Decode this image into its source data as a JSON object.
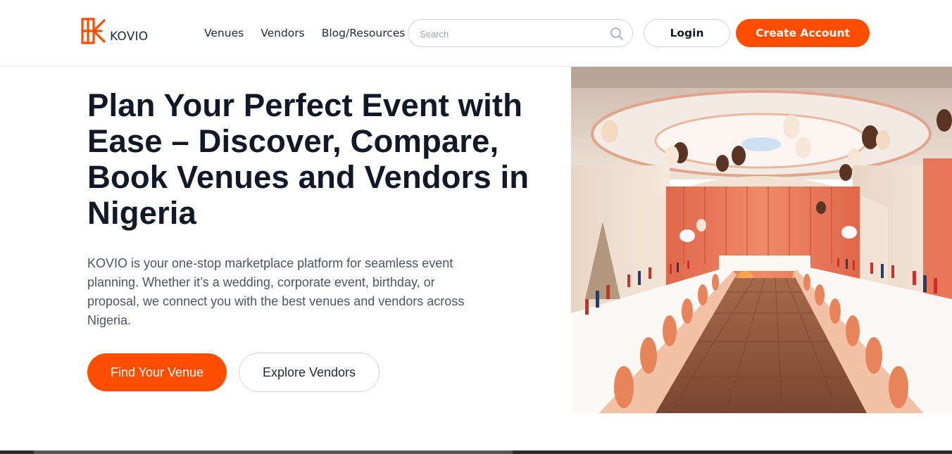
{
  "brand": {
    "name": "KOVIO",
    "accent_color": "#ff4d00"
  },
  "nav": {
    "items": [
      {
        "label": "Venues"
      },
      {
        "label": "Vendors"
      },
      {
        "label": "Blog/Resources"
      }
    ]
  },
  "search": {
    "placeholder": "Search",
    "icon": "search-icon"
  },
  "auth": {
    "login_label": "Login",
    "create_account_label": "Create Account"
  },
  "hero": {
    "title": "Plan Your Perfect Event with Ease – Discover, Compare, Book Venues and Vendors in Nigeria",
    "description": "KOVIO is your one-stop marketplace platform for seamless event planning. Whether it’s a wedding, corporate event, birthday, or proposal, we connect you with the best venues and vendors across Nigeria.",
    "primary_cta": "Find Your Venue",
    "secondary_cta": "Explore Vendors"
  }
}
